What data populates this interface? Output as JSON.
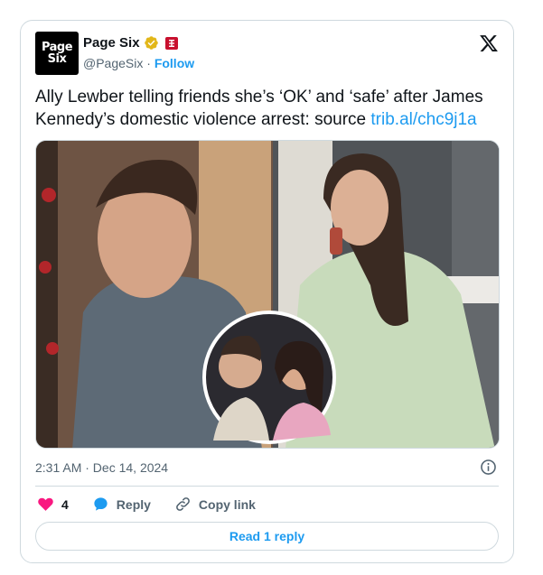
{
  "account": {
    "avatar_line1": "Page",
    "avatar_line2": "Six",
    "name": "Page Six",
    "handle": "@PageSix",
    "separator": "·",
    "follow_label": "Follow"
  },
  "tweet": {
    "text": "Ally Lewber telling friends she’s ‘OK’ and ‘safe’ after James Kennedy’s domestic violence arrest: source ",
    "link_text": "trib.al/chc9j1a",
    "timestamp": "2:31 AM · Dec 14, 2024"
  },
  "actions": {
    "like_count": "4",
    "reply_label": "Reply",
    "copy_link_label": "Copy link"
  },
  "footer": {
    "read_replies_label": "Read 1 reply"
  },
  "colors": {
    "accent": "#1d9bf0",
    "like": "#f91880",
    "verified_gold": "#e2b719",
    "affiliate_red": "#c8102e"
  },
  "icons": [
    "verified-badge-icon",
    "affiliate-icon",
    "x-logo-icon",
    "info-icon",
    "heart-icon",
    "reply-bubble-icon",
    "copy-link-icon"
  ]
}
